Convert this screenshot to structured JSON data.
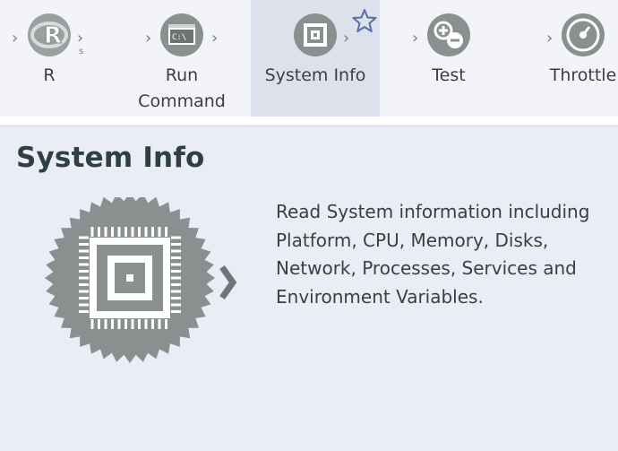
{
  "palette": {
    "tools": [
      {
        "label": "R",
        "icon": "r-icon"
      },
      {
        "label": "Run\nCommand",
        "icon": "terminal-icon",
        "icon_text": "C:\\"
      },
      {
        "label": "System Info",
        "icon": "chip-icon",
        "selected": true
      },
      {
        "label": "Test",
        "icon": "plus-minus-icon"
      },
      {
        "label": "Throttle",
        "icon": "gauge-icon"
      }
    ],
    "favorite_icon": "star-icon"
  },
  "detail": {
    "title": "System Info",
    "icon": "chip-icon",
    "description": "Read System information including Platform, CPU, Memory, Disks, Network, Processes, Services and Environment Variables."
  },
  "colors": {
    "icon_gray": "#8a8f8f",
    "selected_bg": "#dde1ec",
    "panel_bg": "#eaedf6",
    "title": "#2f4040",
    "star": "#5a6ea8"
  }
}
